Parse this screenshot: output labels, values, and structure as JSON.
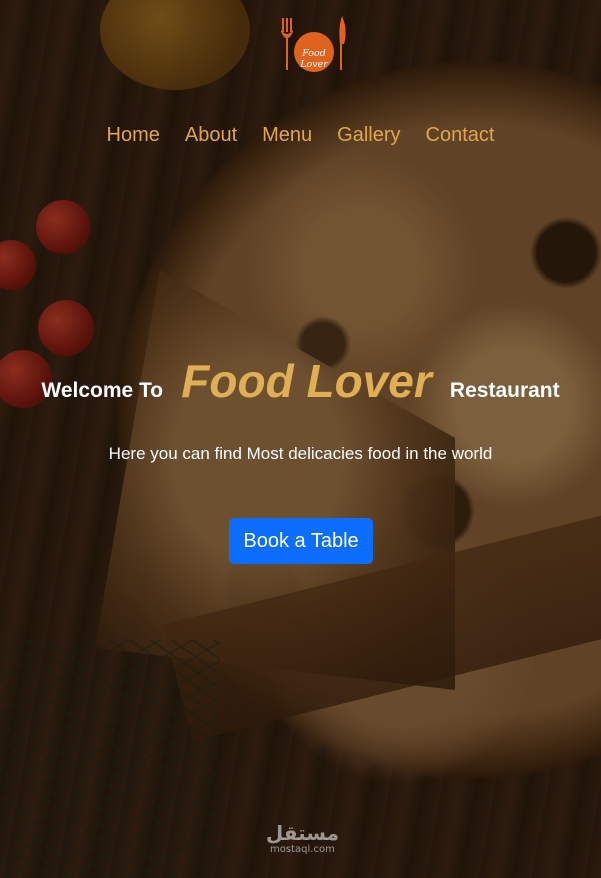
{
  "logo": {
    "text": "Food Lover",
    "color": "#e0621f"
  },
  "nav": {
    "items": [
      {
        "label": "Home"
      },
      {
        "label": "About"
      },
      {
        "label": "Menu"
      },
      {
        "label": "Gallery"
      },
      {
        "label": "Contact"
      }
    ],
    "color": "#e0a64e"
  },
  "hero": {
    "prefix": "Welcome To",
    "brand": "Food Lover",
    "suffix": "Restaurant",
    "subtitle": "Here you can find Most delicacies food in the world",
    "brand_color": "#dfae55"
  },
  "cta": {
    "label": "Book a Table",
    "color": "#0d6efd"
  },
  "watermark": {
    "arabic": "مستقل",
    "latin": "mostaql.com"
  }
}
